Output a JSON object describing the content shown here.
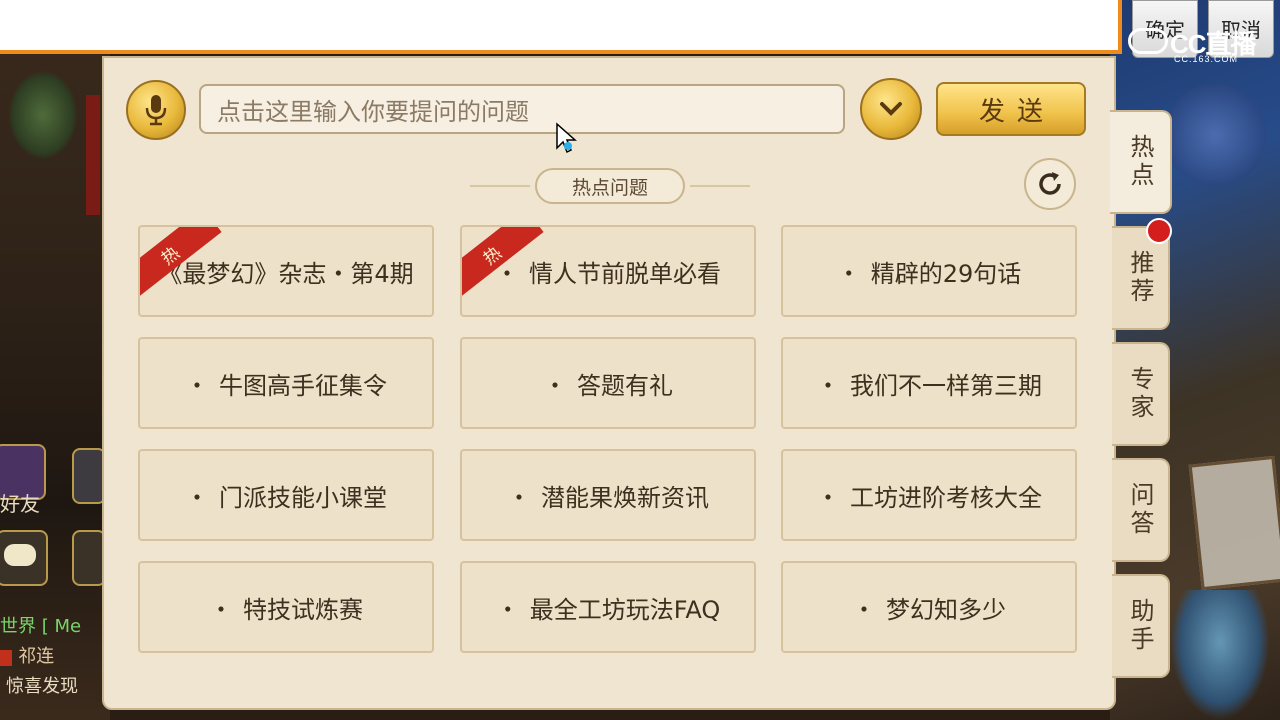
{
  "top_bar": {
    "confirm_label": "确定",
    "cancel_label": "取消"
  },
  "watermark": {
    "main": "CC直播",
    "sub": "CC.163.COM"
  },
  "hud": {
    "friends_label": "好友",
    "chat_lines": [
      "世界 [ Me",
      "祁连",
      "惊喜发现"
    ]
  },
  "search": {
    "placeholder": "点击这里输入你要提问的问题",
    "send_label": "发送",
    "icons": [
      "microphone-icon",
      "chevron-down-icon",
      "refresh-icon"
    ]
  },
  "hot_section": {
    "title": "热点问题",
    "hot_badge": "热",
    "items": [
      {
        "label": "《最梦幻》杂志・第4期",
        "hot": true
      },
      {
        "label": "情人节前脱单必看",
        "hot": true
      },
      {
        "label": "精辟的29句话",
        "hot": false
      },
      {
        "label": "牛图高手征集令",
        "hot": false
      },
      {
        "label": "答题有礼",
        "hot": false
      },
      {
        "label": "我们不一样第三期",
        "hot": false
      },
      {
        "label": "门派技能小课堂",
        "hot": false
      },
      {
        "label": "潜能果焕新资讯",
        "hot": false
      },
      {
        "label": "工坊进阶考核大全",
        "hot": false
      },
      {
        "label": "特技试炼赛",
        "hot": false
      },
      {
        "label": "最全工坊玩法FAQ",
        "hot": false
      },
      {
        "label": "梦幻知多少",
        "hot": false
      }
    ]
  },
  "side_tabs": [
    {
      "label": "热点",
      "active": true
    },
    {
      "label": "推荐",
      "active": false
    },
    {
      "label": "专家",
      "active": false
    },
    {
      "label": "问答",
      "active": false
    },
    {
      "label": "助手",
      "active": false
    }
  ],
  "colors": {
    "accent": "#f08a1c",
    "panel_bg": "#efe5d1",
    "hot_red": "#c8281e",
    "gold": "#e8b83a"
  }
}
